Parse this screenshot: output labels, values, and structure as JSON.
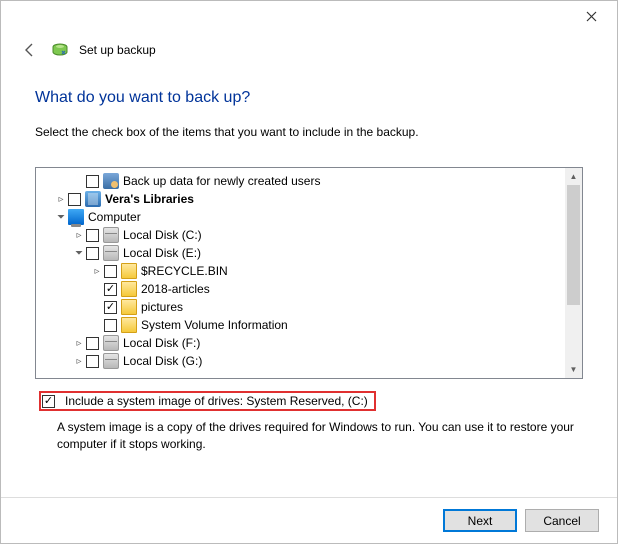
{
  "header": {
    "title": "Set up backup"
  },
  "page": {
    "question": "What do you want to back up?",
    "instruction": "Select the check box of the items that you want to include in the backup."
  },
  "tree": {
    "items": [
      {
        "label": "Back up data for newly created users"
      },
      {
        "label": "Vera's Libraries"
      },
      {
        "label": "Computer"
      },
      {
        "label": "Local Disk (C:)"
      },
      {
        "label": "Local Disk (E:)"
      },
      {
        "label": "$RECYCLE.BIN"
      },
      {
        "label": "2018-articles"
      },
      {
        "label": "pictures"
      },
      {
        "label": "System Volume Information"
      },
      {
        "label": "Local Disk (F:)"
      },
      {
        "label": "Local Disk (G:)"
      }
    ]
  },
  "system_image": {
    "label": "Include a system image of drives: System Reserved, (C:)",
    "description": "A system image is a copy of the drives required for Windows to run. You can use it to restore your computer if it stops working."
  },
  "footer": {
    "next": "Next",
    "cancel": "Cancel"
  }
}
